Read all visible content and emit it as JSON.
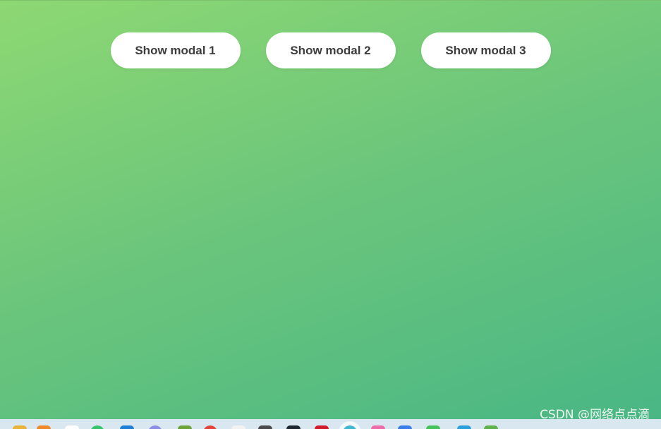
{
  "buttons": [
    {
      "label": "Show modal 1"
    },
    {
      "label": "Show modal 2"
    },
    {
      "label": "Show modal 3"
    }
  ],
  "watermark": "CSDN @网络点点滴",
  "colors": {
    "gradient_start": "#8ed873",
    "gradient_end": "#48b685",
    "button_bg": "#ffffff",
    "button_text": "#3d3d3d"
  },
  "taskbar": {
    "icons": [
      {
        "name": "folder-icon",
        "color": "#e9b23a"
      },
      {
        "name": "document-icon",
        "color": "#ee8a2a"
      },
      {
        "name": "blank-app-icon",
        "color": "#ffffff"
      },
      {
        "name": "chat-app-icon",
        "color": "#35c46b"
      },
      {
        "name": "mail-app-icon",
        "color": "#1f7fd6"
      },
      {
        "name": "browser-app-icon",
        "color": "#8c8ee6"
      },
      {
        "name": "code-app-icon",
        "color": "#6da43a"
      },
      {
        "name": "music-app-icon",
        "color": "#e0443a"
      },
      {
        "name": "notes-app-icon",
        "color": "#f2f2f2"
      },
      {
        "name": "media-app-icon",
        "color": "#4a4a4a"
      },
      {
        "name": "terminal-app-icon",
        "color": "#1d2730"
      },
      {
        "name": "red-app-icon",
        "color": "#d11a2e"
      },
      {
        "name": "active-app-icon",
        "color": "#3fb7d1"
      },
      {
        "name": "pink-app-icon",
        "color": "#ec6ba8"
      },
      {
        "name": "blue-app-icon",
        "color": "#3b7de8"
      },
      {
        "name": "green-app-icon",
        "color": "#45c35b"
      },
      {
        "name": "edit-app-icon",
        "color": "#2a9fd8"
      },
      {
        "name": "leaf-app-icon",
        "color": "#5fb04b"
      }
    ]
  }
}
